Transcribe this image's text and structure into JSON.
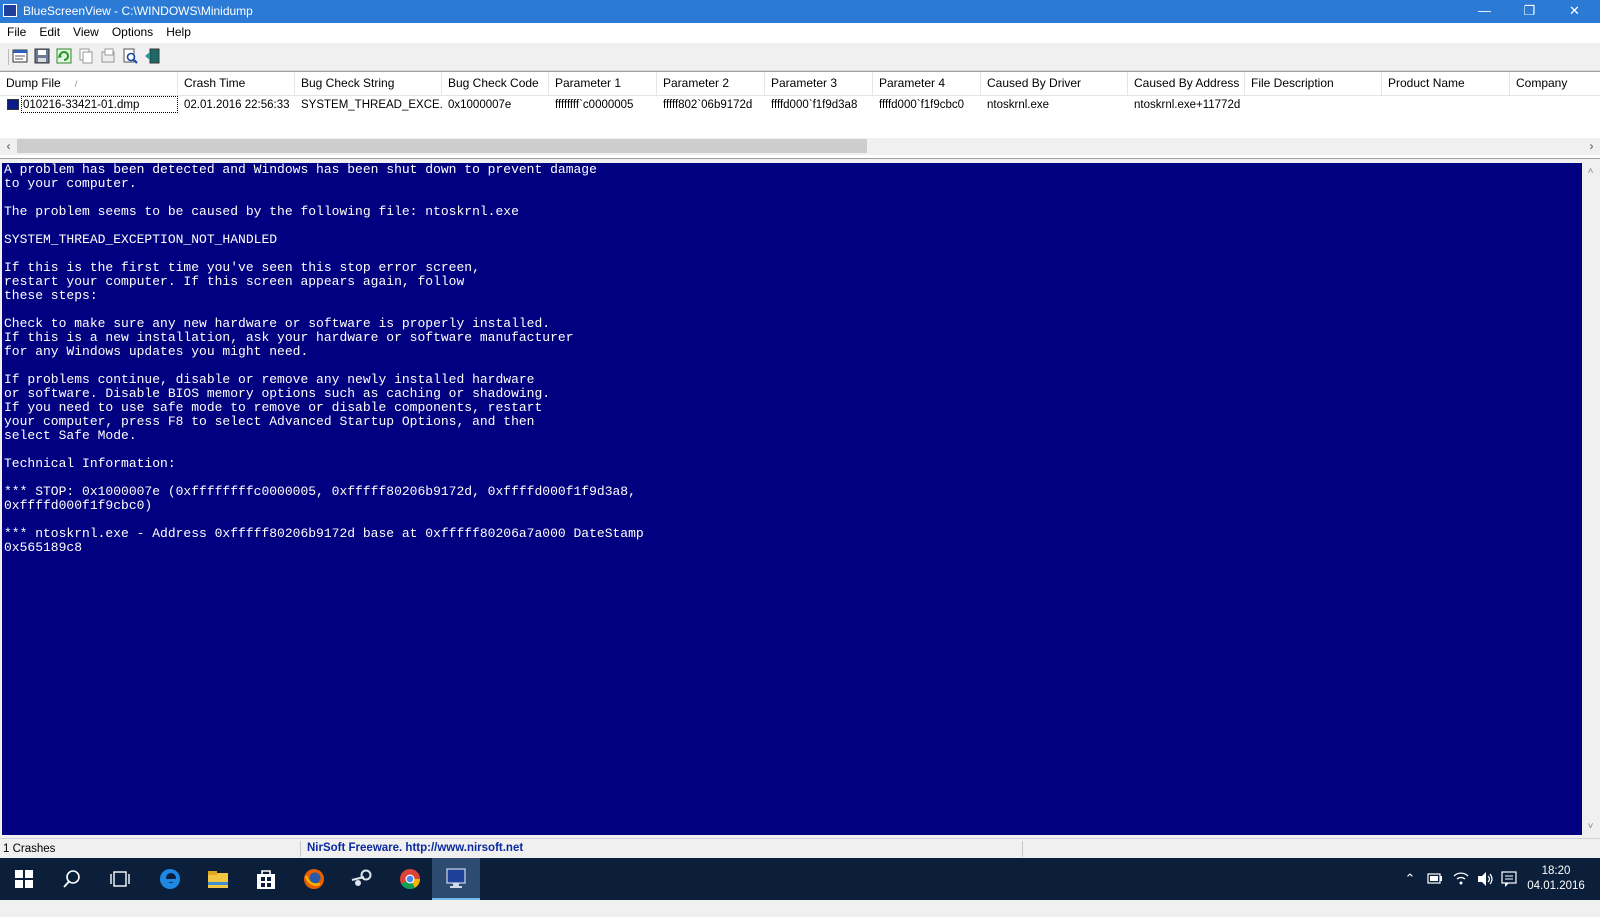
{
  "window": {
    "title": "BlueScreenView  -  C:\\WINDOWS\\Minidump",
    "minimize": "—",
    "restore": "❐",
    "close": "✕"
  },
  "menu": [
    "File",
    "Edit",
    "View",
    "Options",
    "Help"
  ],
  "table": {
    "columns": [
      "Dump File",
      "Crash Time",
      "Bug Check String",
      "Bug Check Code",
      "Parameter 1",
      "Parameter 2",
      "Parameter 3",
      "Parameter 4",
      "Caused By Driver",
      "Caused By Address",
      "File Description",
      "Product Name",
      "Company"
    ],
    "sort_indicator": "/",
    "rows": [
      [
        "010216-33421-01.dmp",
        "02.01.2016 22:56:33",
        "SYSTEM_THREAD_EXCE...",
        "0x1000007e",
        "ffffffff`c0000005",
        "fffff802`06b9172d",
        "ffffd000`f1f9d3a8",
        "ffffd000`f1f9cbc0",
        "ntoskrnl.exe",
        "ntoskrnl.exe+11772d",
        "",
        "",
        ""
      ]
    ]
  },
  "bsod_lines": [
    "A problem has been detected and Windows has been shut down to prevent damage",
    "to your computer.",
    "",
    "The problem seems to be caused by the following file: ntoskrnl.exe",
    "",
    "SYSTEM_THREAD_EXCEPTION_NOT_HANDLED",
    "",
    "If this is the first time you've seen this stop error screen,",
    "restart your computer. If this screen appears again, follow",
    "these steps:",
    "",
    "Check to make sure any new hardware or software is properly installed.",
    "If this is a new installation, ask your hardware or software manufacturer",
    "for any Windows updates you might need.",
    "",
    "If problems continue, disable or remove any newly installed hardware",
    "or software. Disable BIOS memory options such as caching or shadowing.",
    "If you need to use safe mode to remove or disable components, restart",
    "your computer, press F8 to select Advanced Startup Options, and then",
    "select Safe Mode.",
    "",
    "Technical Information:",
    "",
    "*** STOP: 0x1000007e (0xffffffffc0000005, 0xfffff80206b9172d, 0xffffd000f1f9d3a8,",
    "0xffffd000f1f9cbc0)",
    "",
    "*** ntoskrnl.exe - Address 0xfffff80206b9172d base at 0xfffff80206a7a000 DateStamp",
    "0x565189c8"
  ],
  "status": {
    "count": "1 Crashes",
    "link": "NirSoft Freeware.  http://www.nirsoft.net"
  },
  "clock": {
    "time": "18:20",
    "date": "04.01.2016"
  },
  "colors": {
    "titlebar": "#2b7ad6",
    "bsod_background": "#000080",
    "taskbar": "#0b1f3a"
  }
}
